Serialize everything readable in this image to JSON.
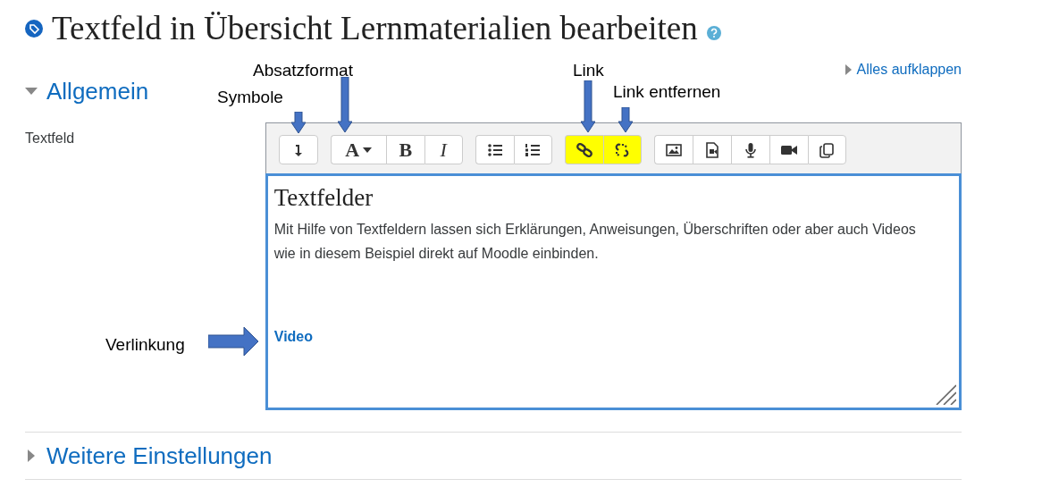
{
  "page_title": "Textfeld in Übersicht Lernmaterialien bearbeiten",
  "expand_all": "Alles aufklappen",
  "sections": [
    {
      "title": "Allgemein",
      "expanded": true
    },
    {
      "title": "Weitere Einstellungen",
      "expanded": false
    }
  ],
  "field_label": "Textfeld",
  "toolbar": {
    "groups": [
      [
        {
          "kind": "symbols",
          "highlighted": false
        }
      ],
      [
        {
          "kind": "format",
          "label": "A",
          "highlighted": false
        },
        {
          "kind": "bold",
          "label": "B",
          "highlighted": false
        },
        {
          "kind": "italic",
          "label": "I",
          "highlighted": false
        }
      ],
      [
        {
          "kind": "bullets",
          "highlighted": false
        },
        {
          "kind": "numbers",
          "highlighted": false
        }
      ],
      [
        {
          "kind": "link",
          "highlighted": true
        },
        {
          "kind": "unlink",
          "highlighted": true
        }
      ],
      [
        {
          "kind": "image",
          "highlighted": false
        },
        {
          "kind": "media",
          "highlighted": false
        },
        {
          "kind": "audio",
          "highlighted": false
        },
        {
          "kind": "video",
          "highlighted": false
        },
        {
          "kind": "files",
          "highlighted": false
        }
      ]
    ]
  },
  "editor": {
    "heading": "Textfelder",
    "paragraph": "Mit Hilfe von Textfeldern lassen sich Erklärungen, Anweisungen, Überschriften oder aber auch Videos wie in diesem Beispiel direkt auf Moodle einbinden.",
    "link": "Video"
  },
  "annotations": [
    {
      "text": "Absatzformat",
      "kind": "down"
    },
    {
      "text": "Symbole",
      "kind": "down"
    },
    {
      "text": "Link",
      "kind": "down"
    },
    {
      "text": "Link entfernen",
      "kind": "down"
    },
    {
      "text": "Verlinkung",
      "kind": "right"
    }
  ]
}
